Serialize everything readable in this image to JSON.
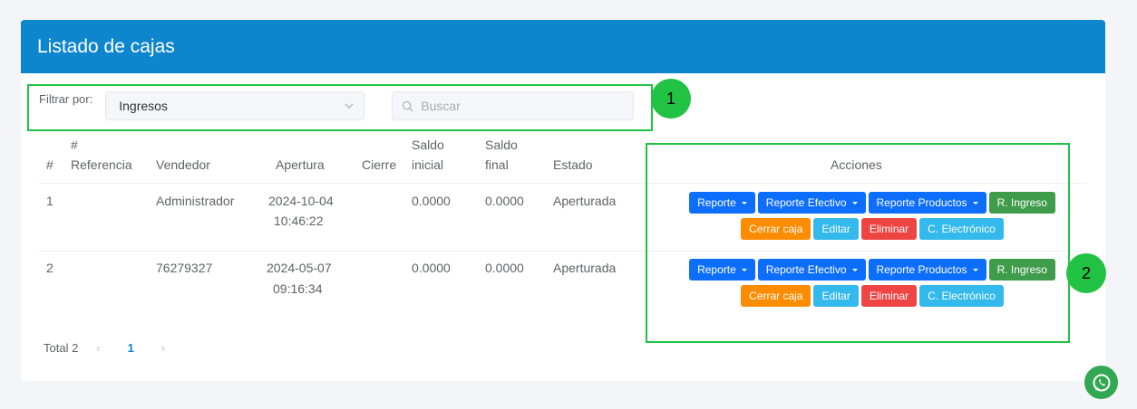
{
  "header": {
    "title": "Listado de cajas"
  },
  "filter": {
    "label": "Filtrar por:",
    "selected": "Ingresos",
    "search_placeholder": "Buscar"
  },
  "columns": {
    "num": "#",
    "ref_1": "#",
    "ref_2": "Referencia",
    "vendedor": "Vendedor",
    "apertura": "Apertura",
    "cierre": "Cierre",
    "saldo_inicial_1": "Saldo",
    "saldo_inicial_2": "inicial",
    "saldo_final_1": "Saldo",
    "saldo_final_2": "final",
    "estado": "Estado",
    "acciones": "Acciones"
  },
  "rows": [
    {
      "num": "1",
      "referencia": "",
      "vendedor": "Administrador",
      "apertura_date": "2024-10-04",
      "apertura_time": "10:46:22",
      "cierre": "",
      "saldo_inicial": "0.0000",
      "saldo_final": "0.0000",
      "estado": "Aperturada"
    },
    {
      "num": "2",
      "referencia": "",
      "vendedor": "76279327",
      "apertura_date": "2024-05-07",
      "apertura_time": "09:16:34",
      "cierre": "",
      "saldo_inicial": "0.0000",
      "saldo_final": "0.0000",
      "estado": "Aperturada"
    }
  ],
  "actions": {
    "reporte": "Reporte",
    "reporte_efectivo": "Reporte Efectivo",
    "reporte_productos": "Reporte Productos",
    "r_ingreso": "R. Ingreso",
    "cerrar_caja": "Cerrar caja",
    "editar": "Editar",
    "eliminar": "Eliminar",
    "c_electronico": "C. Electrónico"
  },
  "pagination": {
    "total": "Total 2",
    "prev": "‹",
    "current_page": "1",
    "next": "›"
  },
  "annotations": {
    "one": "1",
    "two": "2"
  },
  "colors": {
    "header": "#0e86cd",
    "primary_button": "#0d6efd",
    "success_button": "#3f9c4b",
    "warning_button": "#fd8c00",
    "info_button": "#34b9ec",
    "danger_button": "#ef4444",
    "annotation": "#22c244"
  },
  "icons": {
    "select_arrow": "chevron-down-icon",
    "search": "search-icon",
    "whatsapp": "whatsapp-icon"
  }
}
